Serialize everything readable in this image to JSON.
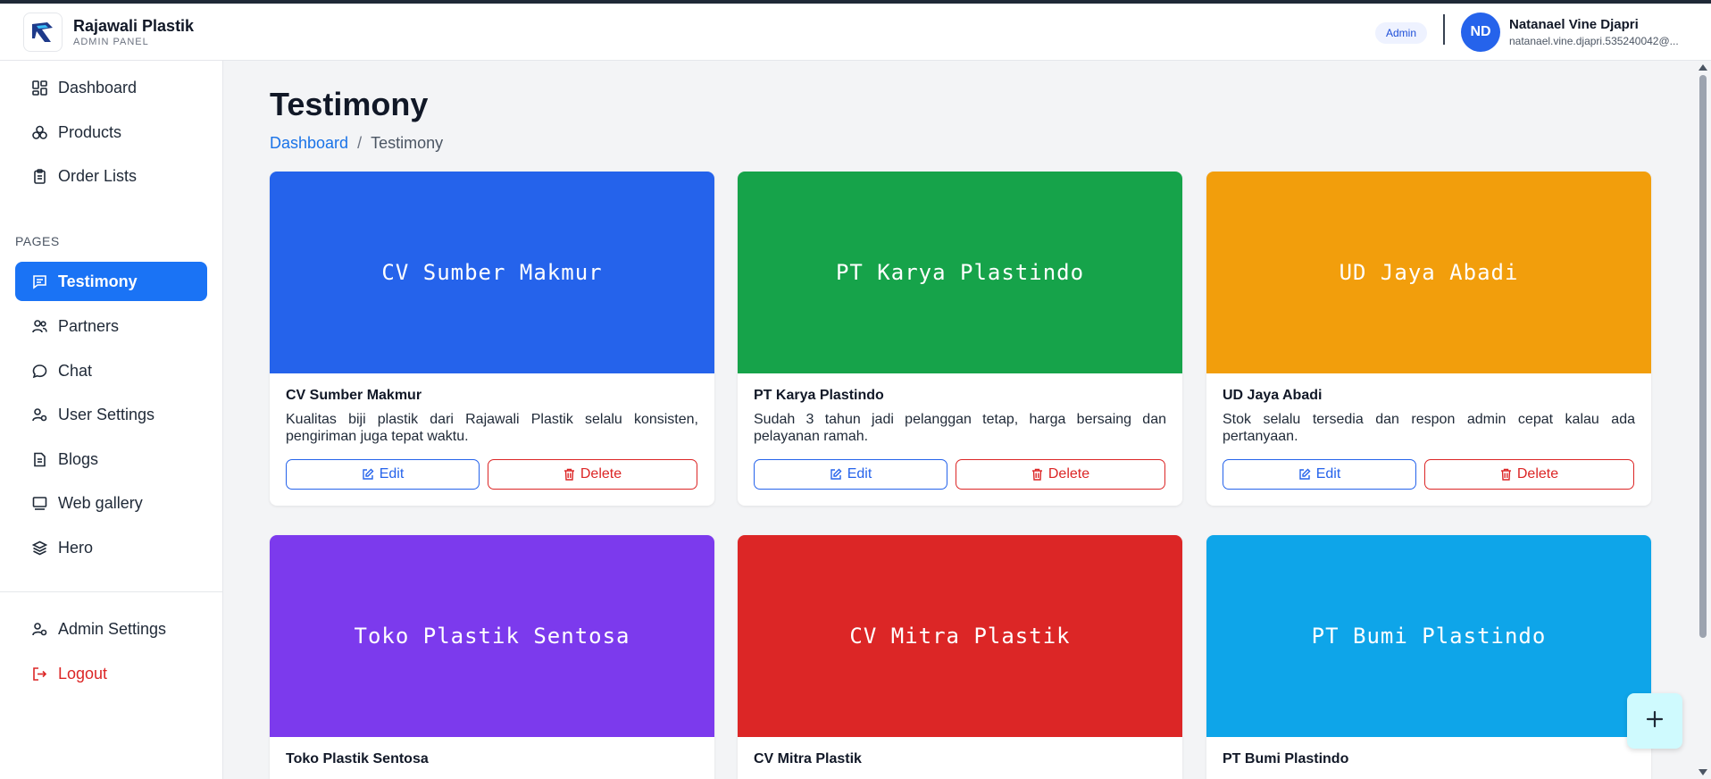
{
  "brand": {
    "name": "Rajawali Plastik",
    "subtitle": "ADMIN PANEL"
  },
  "user": {
    "role": "Admin",
    "initials": "ND",
    "name": "Natanael Vine Djapri",
    "email": "natanael.vine.djapri.535240042@..."
  },
  "sidebar": {
    "items": [
      {
        "label": "Dashboard",
        "icon": "dashboard-icon"
      },
      {
        "label": "Products",
        "icon": "products-icon"
      },
      {
        "label": "Order Lists",
        "icon": "clipboard-icon"
      }
    ],
    "section_label": "PAGES",
    "pages": [
      {
        "label": "Testimony",
        "icon": "message-icon",
        "active": true
      },
      {
        "label": "Partners",
        "icon": "users-icon"
      },
      {
        "label": "Chat",
        "icon": "chat-icon"
      },
      {
        "label": "User Settings",
        "icon": "user-settings-icon"
      },
      {
        "label": "Blogs",
        "icon": "document-icon"
      },
      {
        "label": "Web gallery",
        "icon": "gallery-icon"
      },
      {
        "label": "Hero",
        "icon": "layers-icon"
      }
    ],
    "bottom": [
      {
        "label": "Admin Settings",
        "icon": "admin-settings-icon"
      },
      {
        "label": "Logout",
        "icon": "logout-icon"
      }
    ]
  },
  "page": {
    "title": "Testimony",
    "breadcrumb_home": "Dashboard",
    "breadcrumb_separator": "/",
    "breadcrumb_current": "Testimony"
  },
  "cards": [
    {
      "image_text": "CV Sumber Makmur",
      "color": "#2563eb",
      "title": "CV Sumber Makmur",
      "description": "Kualitas biji plastik dari Rajawali Plastik selalu konsisten, pengiriman juga tepat waktu.",
      "edit_label": "Edit",
      "delete_label": "Delete"
    },
    {
      "image_text": "PT Karya Plastindo",
      "color": "#16a34a",
      "title": "PT Karya Plastindo",
      "description": "Sudah 3 tahun jadi pelanggan tetap, harga bersaing dan pelayanan ramah.",
      "edit_label": "Edit",
      "delete_label": "Delete"
    },
    {
      "image_text": "UD Jaya Abadi",
      "color": "#f29e0c",
      "title": "UD Jaya Abadi",
      "description": "Stok selalu tersedia dan respon admin cepat kalau ada pertanyaan.",
      "edit_label": "Edit",
      "delete_label": "Delete"
    },
    {
      "image_text": "Toko Plastik Sentosa",
      "color": "#7c3aed",
      "title": "Toko Plastik Sentosa"
    },
    {
      "image_text": "CV Mitra Plastik",
      "color": "#dc2626",
      "title": "CV Mitra Plastik"
    },
    {
      "image_text": "PT Bumi Plastindo",
      "color": "#0ea5e9",
      "title": "PT Bumi Plastindo"
    }
  ],
  "fab": {
    "icon": "plus-icon"
  },
  "colors": {
    "accent": "#1a73f5",
    "danger": "#dc2626",
    "primary_button": "#2563eb"
  }
}
